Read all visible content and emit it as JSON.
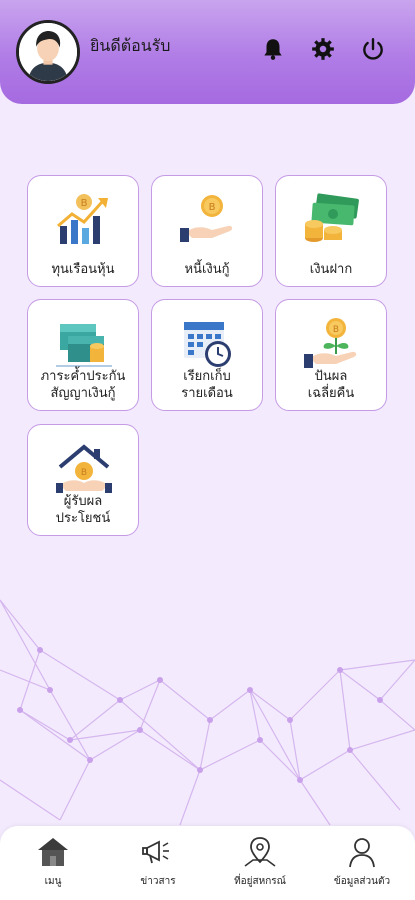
{
  "header": {
    "greeting": "ยินดีต้อนรับ"
  },
  "colors": {
    "accent": "#a56ae0",
    "tile_border": "#c59be6",
    "background": "#f3ebfd"
  },
  "menu": [
    {
      "label": "ทุนเรือนหุ้น",
      "icon": "stock-growth-icon"
    },
    {
      "label": "หนี้เงินกู้",
      "icon": "coin-hand-icon"
    },
    {
      "label": "เงินฝาก",
      "icon": "money-stack-icon"
    },
    {
      "label": "ภาระค้ำประกัน\nสัญญาเงินกู้",
      "icon": "money-pile-icon"
    },
    {
      "label": "เรียกเก็บ\nรายเดือน",
      "icon": "calendar-clock-icon"
    },
    {
      "label": "ปันผล\nเฉลี่ยคืน",
      "icon": "dividend-plant-icon"
    },
    {
      "label": "ผู้รับผล\nประโยชน์",
      "icon": "beneficiary-house-icon"
    }
  ],
  "bottom_nav": [
    {
      "label": "เมนู",
      "icon": "home-icon"
    },
    {
      "label": "ข่าวสาร",
      "icon": "megaphone-icon"
    },
    {
      "label": "ที่อยู่สหกรณ์",
      "icon": "map-pin-icon"
    },
    {
      "label": "ข้อมูลส่วนตัว",
      "icon": "person-icon"
    }
  ]
}
